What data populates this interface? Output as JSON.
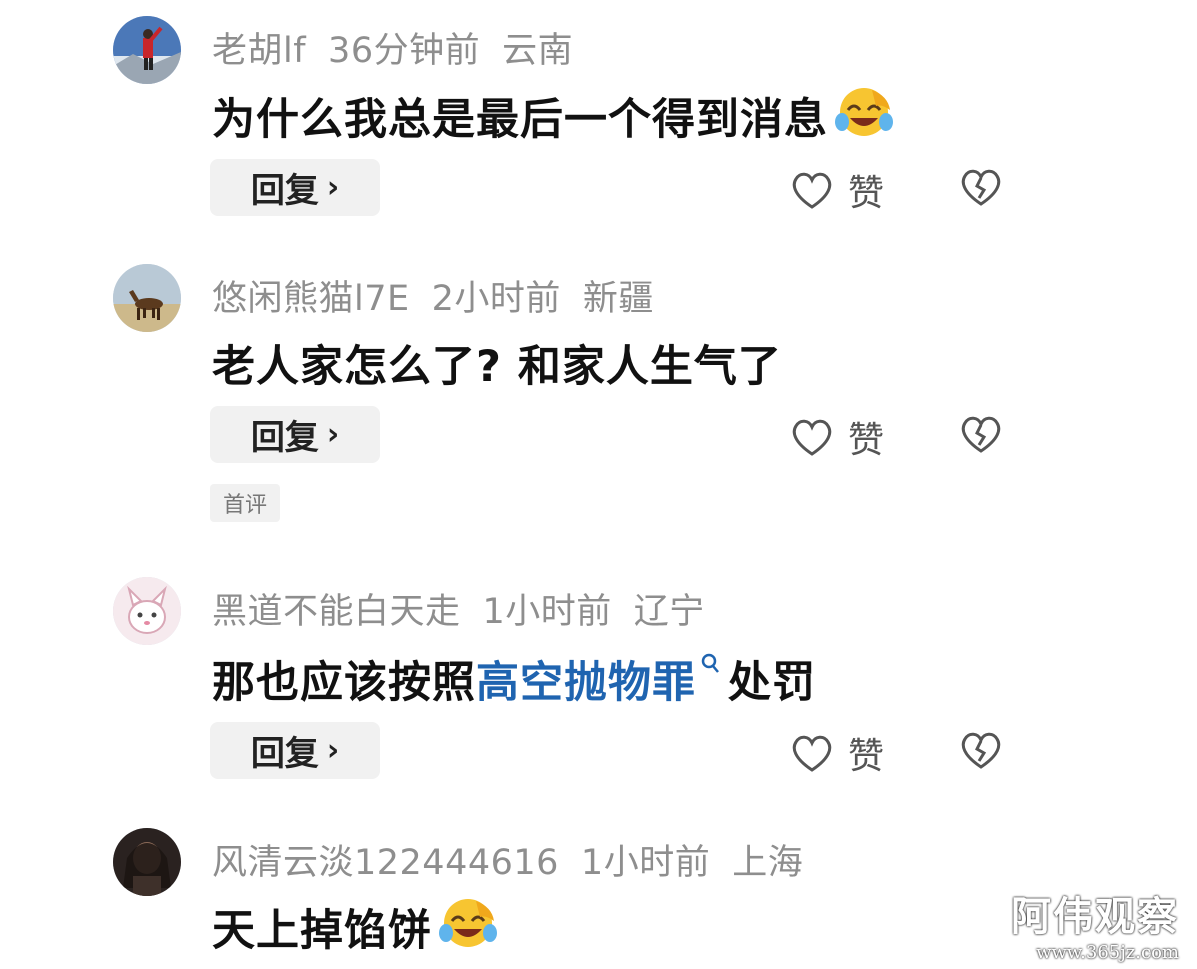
{
  "comments": [
    {
      "username": "老胡lf",
      "time": "36分钟前",
      "location": "云南",
      "text": "为什么我总是最后一个得到消息",
      "emoji": "laughing-crying",
      "reply_label": "回复",
      "like_label": "赞"
    },
    {
      "username": "悠闲熊猫l7E",
      "time": "2小时前",
      "location": "新疆",
      "text": "老人家怎么了? 和家人生气了",
      "reply_label": "回复",
      "like_label": "赞",
      "badge": "首评"
    },
    {
      "username": "黑道不能白天走",
      "time": "1小时前",
      "location": "辽宁",
      "text_before": "那也应该按照",
      "link_text": "高空抛物罪",
      "text_after": "处罚",
      "reply_label": "回复",
      "like_label": "赞"
    },
    {
      "username": "风清云淡122444616",
      "time": "1小时前",
      "location": "上海",
      "text": "天上掉馅饼",
      "emoji": "laughing-crying"
    }
  ],
  "icons": {
    "like": "heart-outline-icon",
    "dislike": "broken-heart-icon",
    "reply_chevron": "chevron-right-icon",
    "link_search": "search-icon"
  },
  "watermark": {
    "title": "阿伟观察",
    "url": "www.365jz.com"
  },
  "colors": {
    "link": "#1f64b0",
    "meta": "#8e8e8e",
    "reply_bg": "#f1f1f1"
  }
}
